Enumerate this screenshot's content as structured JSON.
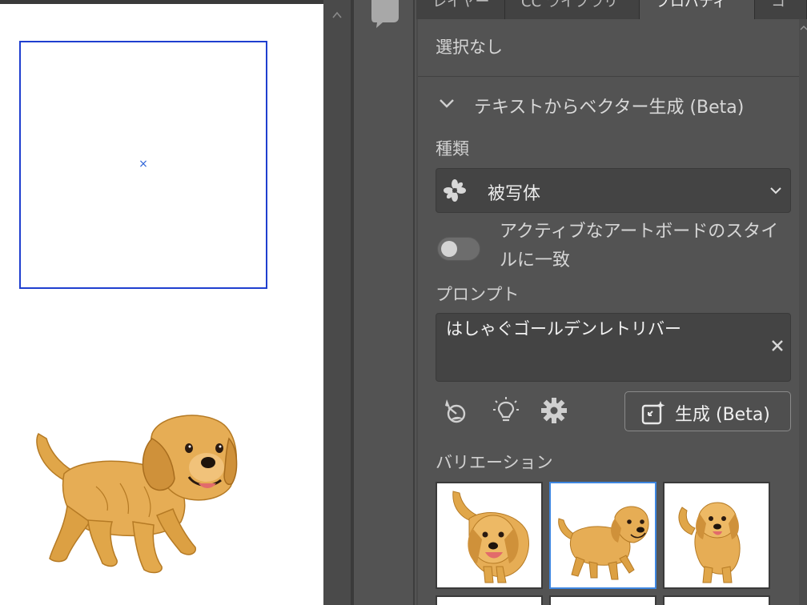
{
  "tabs": [
    {
      "label": "レイヤー"
    },
    {
      "label": "CC ライブラリ"
    },
    {
      "label": "プロパティ"
    },
    {
      "label": "コ"
    }
  ],
  "panel": {
    "selection_status": "選択なし",
    "section_title": "テキストからベクター生成 (Beta)",
    "type_label": "種類",
    "type_value": "被写体",
    "match_style_label": "アクティブなアートボードのスタイルに一致",
    "match_style_on": false,
    "prompt_label": "プロンプト",
    "prompt_value": "はしゃぐゴールデンレトリバー",
    "generate_label": "生成 (Beta)",
    "variations_label": "バリエーション",
    "selected_variation_index": 1
  },
  "icons": {
    "comment": "comment-icon",
    "center": "×",
    "flower": "flower-icon",
    "dropdown": "chevron-down-icon",
    "clear": "close-icon",
    "style_picker": "style-picker-icon",
    "sample_prompts": "lightbulb-icon",
    "settings": "gear-icon",
    "generate": "generate-sparkle-icon"
  },
  "colors": {
    "artboard_border": "#1f3fcf",
    "selection_highlight": "#3d86e0",
    "dog_fur": "#e0a649"
  }
}
